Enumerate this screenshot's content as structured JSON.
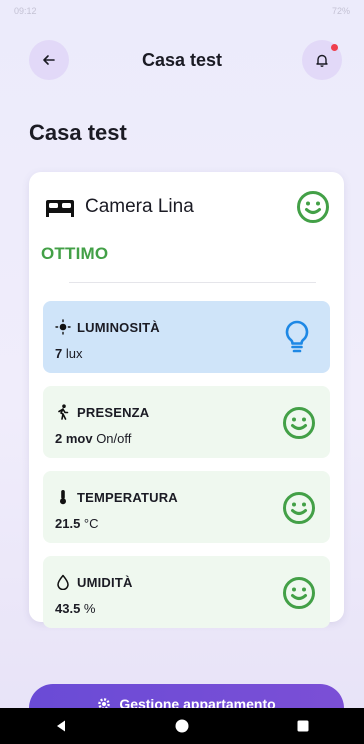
{
  "status_bar": {
    "time": "09:12",
    "right": "72%"
  },
  "app_bar": {
    "title": "Casa test",
    "back_icon": "arrow-left-icon",
    "notification_icon": "bell-icon",
    "notification_dot_color": "#ef3f4d"
  },
  "page": {
    "title": "Casa test"
  },
  "room": {
    "icon": "bed-icon",
    "name": "Camera Lina",
    "status": "OTTIMO",
    "status_color": "#43a047",
    "status_icon": "smile-face-icon"
  },
  "sensors": [
    {
      "label": "LUMINOSITÀ",
      "icon": "brightness-icon",
      "value": "7",
      "unit": " lux",
      "indicator_icon": "lightbulb-icon",
      "bg_color": "#cfe4f9",
      "indicator_color": "#1e88e5"
    },
    {
      "label": "PRESENZA",
      "icon": "walking-person-icon",
      "value": "2 mov",
      "unit": " On/off",
      "indicator_icon": "smile-face-icon",
      "bg_color": "#eff8ef",
      "indicator_color": "#43a047"
    },
    {
      "label": "TEMPERATURA",
      "icon": "thermometer-icon",
      "value": "21.5",
      "unit": " °C",
      "indicator_icon": "smile-face-icon",
      "bg_color": "#eff8ef",
      "indicator_color": "#43a047"
    },
    {
      "label": "UMIDITÀ",
      "icon": "water-drop-icon",
      "value": "43.5",
      "unit": " %",
      "indicator_icon": "smile-face-icon",
      "bg_color": "#eff8ef",
      "indicator_color": "#43a047"
    }
  ],
  "cta": {
    "label": "Gestione appartamento",
    "icon": "gear-icon"
  },
  "nav_bar": {
    "back_icon": "triangle-back-icon",
    "home_icon": "circle-home-icon",
    "recents_icon": "square-recents-icon"
  }
}
